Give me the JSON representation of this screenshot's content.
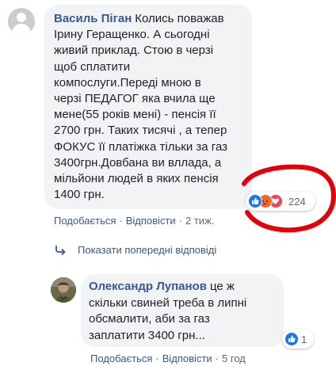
{
  "comment1": {
    "author": "Василь Піган",
    "lines": [
      "Колись поважав",
      "Ірину Геращенко. А сьогодні",
      "живий приклад. Стою в черзі",
      "щоб сплатити",
      "компослуги.Переді мною в",
      "черзі ПЕДАГОГ яка вчила ще",
      "мене(55 років мені) - пенсія її",
      "2700 грн. Таких тисячі , а тепер",
      "ФОКУС її платіжка тільки за газ",
      "3400грн.Довбана ви вллада, а",
      "мільйони людей в яких пенсія",
      "1400 грн."
    ],
    "reaction_count": "224",
    "reaction_icons": [
      "like-icon",
      "angry-icon",
      "love-icon"
    ],
    "actions": {
      "like": "Подобається",
      "reply": "Відповісти",
      "time": "2 тиж."
    }
  },
  "show_previous": "Показати попередні відповіді",
  "comment2": {
    "author": "Олександр Лупанов",
    "lines": [
      "це ж",
      "скільки свиней треба в липні",
      "обсмалити, аби за газ",
      "заплатити 3400 грн..."
    ],
    "reaction_count": "1",
    "reaction_icons": [
      "like-icon"
    ],
    "actions": {
      "like": "Подобається",
      "reply": "Відповісти",
      "time": "5 год"
    }
  },
  "colors": {
    "link": "#385898",
    "bubble": "#f2f3f5",
    "annotation": "#e3000b",
    "like": "#1877f2"
  },
  "separator": "·"
}
